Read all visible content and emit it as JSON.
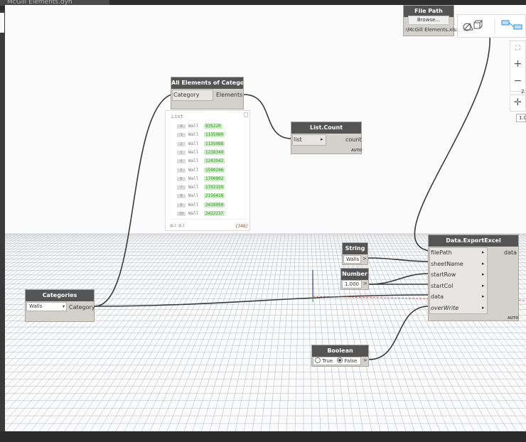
{
  "window": {
    "title": "McGill Elements.dyn"
  },
  "nodes": {
    "file_path": {
      "title": "File Path",
      "browse_label": "Browse...",
      "value": ":\\McGill Elements.xlsx"
    },
    "all_elements": {
      "title": "All Elements of Category",
      "in_port": "Category",
      "out_port": "Elements"
    },
    "list_count": {
      "title": "List.Count",
      "in_port": "list",
      "out_port": "count",
      "lacing": "AUTO"
    },
    "categories": {
      "title": "Categories",
      "selected": "Walls",
      "out_port": "Category"
    },
    "string": {
      "title": "String",
      "value": "Walls"
    },
    "number": {
      "title": "Number",
      "value": "1.000"
    },
    "boolean": {
      "title": "Boolean",
      "true_label": "True",
      "false_label": "False"
    },
    "export_excel": {
      "title": "Data.ExportExcel",
      "inputs": [
        "filePath",
        "sheetName",
        "startRow",
        "startCol",
        "data",
        "overWrite"
      ],
      "out_port": "data",
      "lacing": "AUTO"
    }
  },
  "preview": {
    "header": "List",
    "rows": [
      {
        "index": "0",
        "label": "Wall",
        "value": "835220"
      },
      {
        "index": "1",
        "label": "Wall",
        "value": "1135980"
      },
      {
        "index": "2",
        "label": "Wall",
        "value": "1135988"
      },
      {
        "index": "3",
        "label": "Wall",
        "value": "1238349"
      },
      {
        "index": "4",
        "label": "Wall",
        "value": "1243942"
      },
      {
        "index": "5",
        "label": "Wall",
        "value": "1596246"
      },
      {
        "index": "6",
        "label": "Wall",
        "value": "1700802"
      },
      {
        "index": "7",
        "label": "Wall",
        "value": "1702159"
      },
      {
        "index": "8",
        "label": "Wall",
        "value": "2156418"
      },
      {
        "index": "9",
        "label": "Wall",
        "value": "2419950"
      },
      {
        "index": "10",
        "label": "Wall",
        "value": "2422237"
      }
    ],
    "footer": "@L2 @L1",
    "count": "{348}"
  },
  "viewport": {
    "zoom_in": "+",
    "zoom_out": "−",
    "fit_icon": "fit-view-icon",
    "pan_icon": "pan-icon",
    "partial_text_1": "2.",
    "partial_text_2": "1.00"
  },
  "colors": {
    "node_header": "#545454",
    "node_body": "#d4d1cd",
    "wire": "#3a3a3a",
    "preview_value": "#c9f0c2"
  }
}
